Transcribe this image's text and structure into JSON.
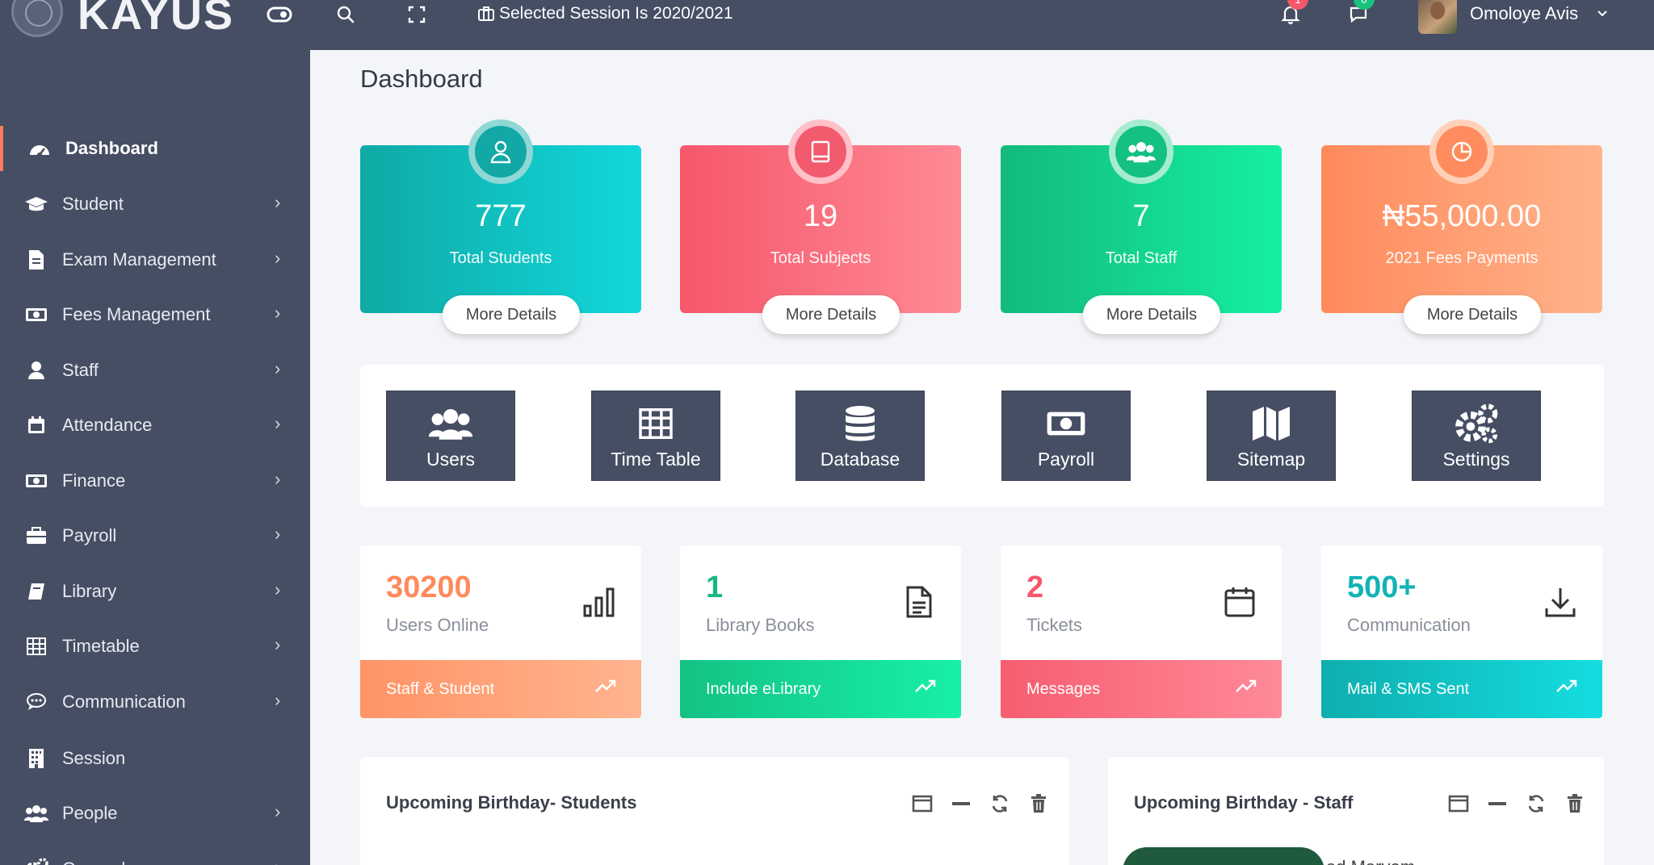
{
  "app": {
    "brand": "KAYUS"
  },
  "topbar": {
    "session_text": "Selected Session Is 2020/2021",
    "notifications_badge": "1",
    "messages_badge": "0",
    "user_name": "Omoloye Avis"
  },
  "sidebar": {
    "items": [
      {
        "label": "Dashboard",
        "icon": "dashboard-icon",
        "active": true,
        "has_chevron": false
      },
      {
        "label": "Student",
        "icon": "graduation-cap-icon",
        "has_chevron": true
      },
      {
        "label": "Exam Management",
        "icon": "file-icon",
        "has_chevron": true
      },
      {
        "label": "Fees Management",
        "icon": "money-icon",
        "has_chevron": true
      },
      {
        "label": "Staff",
        "icon": "user-icon",
        "has_chevron": true
      },
      {
        "label": "Attendance",
        "icon": "calendar-icon",
        "has_chevron": true
      },
      {
        "label": "Finance",
        "icon": "money-icon",
        "has_chevron": true
      },
      {
        "label": "Payroll",
        "icon": "briefcase-icon",
        "has_chevron": true
      },
      {
        "label": "Library",
        "icon": "book-icon",
        "has_chevron": true
      },
      {
        "label": "Timetable",
        "icon": "table-icon",
        "has_chevron": true
      },
      {
        "label": "Communication",
        "icon": "chat-icon",
        "has_chevron": true
      },
      {
        "label": "Session",
        "icon": "building-icon",
        "has_chevron": false
      },
      {
        "label": "People",
        "icon": "users-icon",
        "has_chevron": true
      },
      {
        "label": "General",
        "icon": "cogs-icon",
        "has_chevron": true
      }
    ]
  },
  "main": {
    "title": "Dashboard",
    "stat_cards": [
      {
        "value": "777",
        "label": "Total Students",
        "button": "More Details",
        "icon": "user-icon",
        "colors": [
          "#0fa9a4",
          "#12d8dc"
        ]
      },
      {
        "value": "19",
        "label": "Total Subjects",
        "button": "More Details",
        "icon": "book-icon",
        "colors": [
          "#f6576b",
          "#ff8a96"
        ]
      },
      {
        "value": "7",
        "label": "Total Staff",
        "button": "More Details",
        "icon": "users-icon",
        "colors": [
          "#13b97d",
          "#15f0a0"
        ]
      },
      {
        "value": "₦55,000.00",
        "label": "2021 Fees Payments",
        "button": "More Details",
        "icon": "pie-chart-icon",
        "colors": [
          "#ff8a5c",
          "#ffb38a"
        ]
      }
    ],
    "quick_links": [
      {
        "label": "Users",
        "icon": "users-icon"
      },
      {
        "label": "Time Table",
        "icon": "table-icon"
      },
      {
        "label": "Database",
        "icon": "database-icon"
      },
      {
        "label": "Payroll",
        "icon": "money-icon"
      },
      {
        "label": "Sitemap",
        "icon": "map-icon"
      },
      {
        "label": "Settings",
        "icon": "cogs-icon"
      }
    ],
    "info_cards": [
      {
        "value": "30200",
        "label": "Users Online",
        "footer": "Staff & Student",
        "icon": "bar-chart-icon",
        "value_color": "#ff8a5c",
        "footer_colors": [
          "#ff9466",
          "#ffb48f"
        ]
      },
      {
        "value": "1",
        "label": "Library Books",
        "footer": "Include eLibrary",
        "icon": "document-icon",
        "value_color": "#18b981",
        "footer_colors": [
          "#13c284",
          "#18f0a6"
        ]
      },
      {
        "value": "2",
        "label": "Tickets",
        "footer": "Messages",
        "icon": "calendar-icon",
        "value_color": "#f6576b",
        "footer_colors": [
          "#f65d70",
          "#ff8a99"
        ]
      },
      {
        "value": "500+",
        "label": "Communication",
        "footer": "Mail & SMS Sent",
        "icon": "download-icon",
        "value_color": "#12b3b5",
        "footer_colors": [
          "#0faeae",
          "#14dde0"
        ]
      }
    ],
    "panels": [
      {
        "title": "Upcoming Birthday- Students"
      },
      {
        "title": "Upcoming Birthday - Staff",
        "partial_text": "ad Marvem"
      }
    ]
  }
}
